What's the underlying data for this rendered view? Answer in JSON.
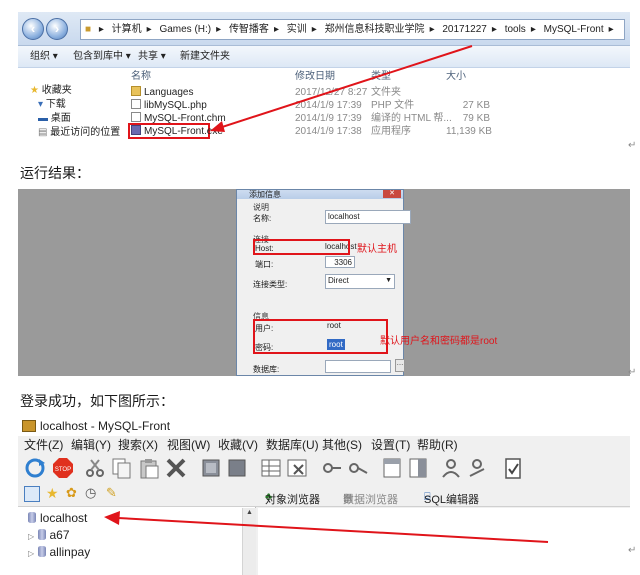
{
  "explorer": {
    "breadcrumb": [
      "计算机",
      "Games (H:)",
      "传智播客",
      "实训",
      "郑州信息科技职业学院",
      "20171227",
      "tools",
      "MySQL-Front"
    ],
    "toolbar": [
      "组织 ▾",
      "包含到库中 ▾",
      "共享 ▾",
      "新建文件夹"
    ],
    "nav": [
      "收藏夹",
      "下载",
      "桌面",
      "最近访问的位置"
    ],
    "columns": {
      "name": "名称",
      "modified": "修改日期",
      "type": "类型",
      "size": "大小"
    },
    "files": [
      {
        "name": "Languages",
        "modified": "2017/12/27 8:27",
        "type": "文件夹",
        "size": "",
        "icon": "folder-icon"
      },
      {
        "name": "libMySQL.php",
        "modified": "2014/1/9 17:39",
        "type": "PHP 文件",
        "size": "27 KB",
        "icon": "php-file-icon"
      },
      {
        "name": "MySQL-Front.chm",
        "modified": "2014/1/9 17:39",
        "type": "编译的 HTML 帮...",
        "size": "79 KB",
        "icon": "chm-file-icon"
      },
      {
        "name": "MySQL-Front.exe",
        "modified": "2014/1/9 17:38",
        "type": "应用程序",
        "size": "11,139 KB",
        "icon": "exe-file-icon"
      }
    ]
  },
  "caption1": "运行结果：",
  "dialog": {
    "title": "添加信息",
    "section_desc": "说明",
    "name_label": "名称:",
    "name_value": "localhost",
    "section_conn": "连接",
    "host_label": "Host:",
    "host_value": "localhost",
    "port_label": "端口:",
    "port_value": "3306",
    "conntype_label": "连接类型:",
    "conntype_value": "Direct",
    "section_info": "信息",
    "user_label": "用户:",
    "user_value": "root",
    "pass_label": "密码:",
    "pass_value": "root",
    "db_label": "数据库:"
  },
  "annotation_host": "默认主机",
  "annotation_user": "默认用户名和密码都是root",
  "caption2": "登录成功，如下图所示：",
  "app": {
    "title": "localhost - MySQL-Front",
    "menu": [
      "文件(Z)",
      "编辑(Y)",
      "搜索(X)",
      "视图(W)",
      "收藏(V)",
      "数据库(U)",
      "其他(S)",
      "设置(T)",
      "帮助(R)"
    ],
    "tabs": [
      "对象浏览器",
      "数据浏览器",
      "SQL编辑器"
    ],
    "tree": [
      "localhost",
      "a67",
      "allinpay"
    ]
  },
  "colors": {
    "annotation": "#e0141a",
    "titlebar": "#c9d9ee"
  }
}
